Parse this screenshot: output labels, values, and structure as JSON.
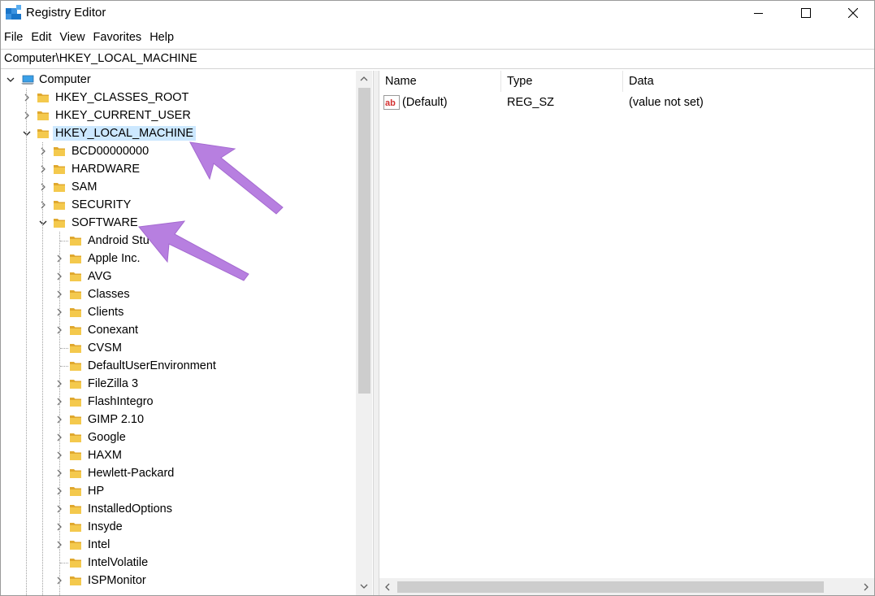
{
  "window": {
    "title": "Registry Editor",
    "icon": "registry-editor-icon"
  },
  "menu": [
    "File",
    "Edit",
    "View",
    "Favorites",
    "Help"
  ],
  "address": "Computer\\HKEY_LOCAL_MACHINE",
  "tree": {
    "root": "Computer",
    "hives": [
      {
        "label": "HKEY_CLASSES_ROOT",
        "state": "collapsed"
      },
      {
        "label": "HKEY_CURRENT_USER",
        "state": "collapsed"
      },
      {
        "label": "HKEY_LOCAL_MACHINE",
        "state": "expanded",
        "selected": true
      }
    ],
    "hklm_children": [
      {
        "label": "BCD00000000",
        "state": "collapsed"
      },
      {
        "label": "HARDWARE",
        "state": "collapsed"
      },
      {
        "label": "SAM",
        "state": "collapsed"
      },
      {
        "label": "SECURITY",
        "state": "collapsed"
      },
      {
        "label": "SOFTWARE",
        "state": "expanded"
      }
    ],
    "software_children": [
      {
        "label": "Android Stu",
        "state": "leaf"
      },
      {
        "label": "Apple Inc.",
        "state": "collapsed"
      },
      {
        "label": "AVG",
        "state": "collapsed"
      },
      {
        "label": "Classes",
        "state": "collapsed"
      },
      {
        "label": "Clients",
        "state": "collapsed"
      },
      {
        "label": "Conexant",
        "state": "collapsed"
      },
      {
        "label": "CVSM",
        "state": "leaf"
      },
      {
        "label": "DefaultUserEnvironment",
        "state": "leaf"
      },
      {
        "label": "FileZilla 3",
        "state": "collapsed"
      },
      {
        "label": "FlashIntegro",
        "state": "collapsed"
      },
      {
        "label": "GIMP 2.10",
        "state": "collapsed"
      },
      {
        "label": "Google",
        "state": "collapsed"
      },
      {
        "label": "HAXM",
        "state": "collapsed"
      },
      {
        "label": "Hewlett-Packard",
        "state": "collapsed"
      },
      {
        "label": "HP",
        "state": "collapsed"
      },
      {
        "label": "InstalledOptions",
        "state": "collapsed"
      },
      {
        "label": "Insyde",
        "state": "collapsed"
      },
      {
        "label": "Intel",
        "state": "collapsed"
      },
      {
        "label": "IntelVolatile",
        "state": "leaf"
      },
      {
        "label": "ISPMonitor",
        "state": "collapsed"
      }
    ]
  },
  "values": {
    "columns": [
      "Name",
      "Type",
      "Data"
    ],
    "rows": [
      {
        "name": "(Default)",
        "type": "REG_SZ",
        "data": "(value not set)",
        "icon": "string-value-icon"
      }
    ]
  },
  "colors": {
    "selection": "#cce8ff",
    "folder": "#f4c94d",
    "annotation_arrow": "#b77fe0"
  }
}
